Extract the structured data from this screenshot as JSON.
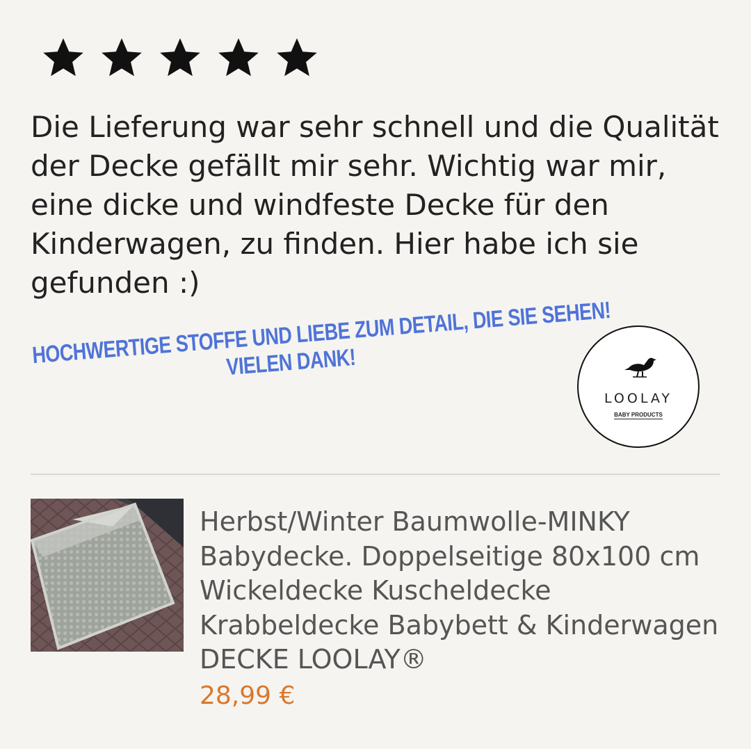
{
  "rating": {
    "value": 5,
    "max": 5
  },
  "review": {
    "text": "Die Lieferung war sehr schnell und die Qualität der Decke gefällt mir sehr. Wichtig war mir, eine dicke und windfeste Decke für den Kinderwagen, zu finden. Hier habe ich sie gefunden :)"
  },
  "banner": {
    "line1": "HOCHWERTIGE STOFFE UND LIEBE ZUM DETAIL, DIE SIE SEHEN!",
    "line2": "VIELEN DANK!",
    "color": "#4f73d8"
  },
  "logo": {
    "brand": "LOOLAY",
    "subtitle": "BABY PRODUCTS",
    "icon": "bird-icon"
  },
  "product": {
    "title": "Herbst/Winter Baumwolle-MINKY Babydecke. Doppelseitige 80x100 cm Wickeldecke Kuscheldecke Krabbeldecke Babybett & Kinderwagen DECKE LOOLAY®",
    "price": "28,99 €",
    "price_color": "#d9782d"
  }
}
